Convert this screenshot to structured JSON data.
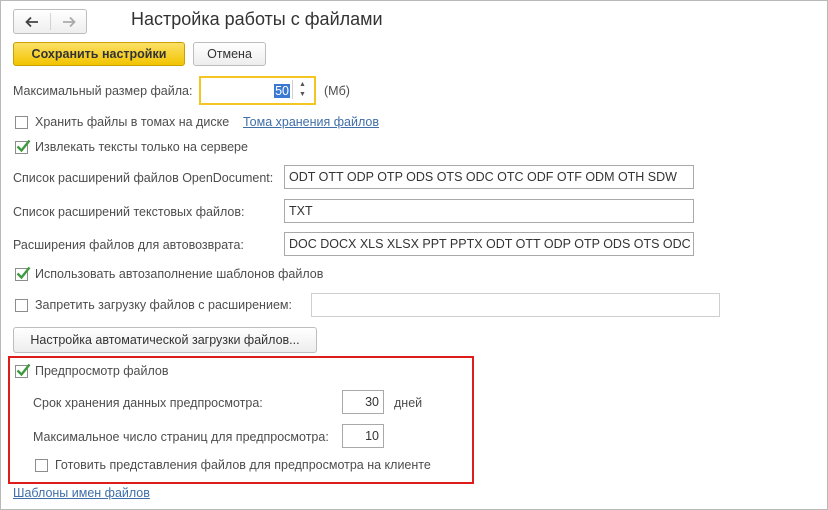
{
  "nav": {
    "back_icon": "arrow-left-icon",
    "forward_icon": "arrow-right-icon"
  },
  "title": "Настройка работы с файлами",
  "toolbar": {
    "save_label": "Сохранить настройки",
    "cancel_label": "Отмена"
  },
  "max_file_size": {
    "label": "Максимальный размер файла:",
    "value": "50",
    "unit": "(Мб)"
  },
  "store_in_volumes": {
    "label": "Хранить файлы в томах на диске",
    "checked": false,
    "link": "Тома хранения файлов"
  },
  "extract_texts": {
    "label": "Извлекать тексты только на сервере",
    "checked": true
  },
  "opendoc_ext": {
    "label": "Список расширений файлов OpenDocument:",
    "value": "ODT OTT ODP OTP ODS OTS ODC OTC ODF OTF ODM OTH SDW"
  },
  "text_ext": {
    "label": "Список расширений текстовых файлов:",
    "value": "TXT"
  },
  "autoreturn_ext": {
    "label": "Расширения файлов для автовозврата:",
    "value": "DOC DOCX XLS XLSX PPT PPTX ODT OTT ODP OTP ODS OTS ODC"
  },
  "autofill_templates": {
    "label": "Использовать автозаполнение шаблонов файлов",
    "checked": true
  },
  "forbid_upload": {
    "label": "Запретить загрузку файлов с расширением:",
    "checked": false,
    "value": ""
  },
  "auto_upload_button": "Настройка автоматической загрузки файлов...",
  "preview": {
    "label": "Предпросмотр файлов",
    "checked": true,
    "retention_label": "Срок хранения данных предпросмотра:",
    "retention_value": "30",
    "retention_unit": "дней",
    "max_pages_label": "Максимальное число страниц для предпросмотра:",
    "max_pages_value": "10",
    "client_prepare_label": "Готовить представления файлов для предпросмотра на клиенте",
    "client_prepare_checked": false
  },
  "name_templates_link": "Шаблоны имен файлов",
  "colors": {
    "primary_button": "#f2c400",
    "focus_border": "#f3c623",
    "highlight_box": "#dd1c1c",
    "link": "#3f6fa8",
    "checkmark": "#3d9a3d"
  }
}
